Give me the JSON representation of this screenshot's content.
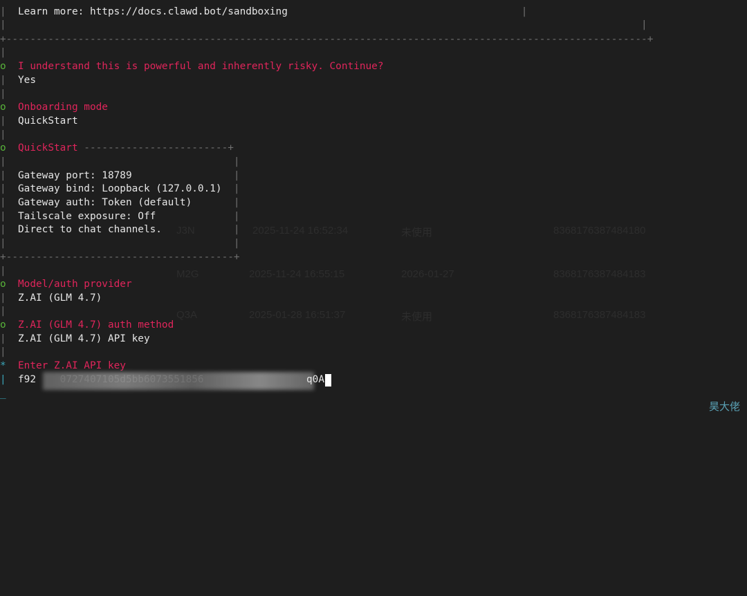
{
  "terminal": {
    "sandbox_box": {
      "learn_more": "Learn more: https://docs.clawd.bot/sandboxing"
    },
    "prompts": {
      "risk_question": "I understand this is powerful and inherently risky. Continue?",
      "risk_answer": "Yes",
      "onboarding_title": "Onboarding mode",
      "onboarding_value": "QuickStart",
      "quickstart_title": "QuickStart",
      "model_title": "Model/auth provider",
      "model_value": "Z.AI (GLM 4.7)",
      "auth_title": "Z.AI (GLM 4.7) auth method",
      "auth_value": "Z.AI (GLM 4.7) API key",
      "api_key_title": "Enter Z.AI API key",
      "api_key_visible_start": "f92",
      "api_key_obscured": "    0727407105d5bb6073551856",
      "api_key_visible_end": "q0A"
    },
    "quickstart_lines": [
      "Gateway port: 18789",
      "Gateway bind: Loopback (127.0.0.1)",
      "Gateway auth: Token (default)",
      "Tailscale exposure: Off",
      "Direct to chat channels."
    ]
  },
  "ghost_table": {
    "row_times": [
      "2025-11-24 16:52:34",
      "2025-11-24 16:55:15",
      "2025-01-28 16:51:37"
    ],
    "row_states": [
      "未使用",
      "2026-01-27",
      "未使用"
    ],
    "row_ids": [
      "8368176387484180",
      "8368176387484183",
      "8368176387484183"
    ],
    "row_codes": [
      "J3N",
      "M2G",
      "Q3A"
    ]
  },
  "watermark": "昊大佬",
  "colors": {
    "background": "#1e1e1e",
    "prompt_title": "#e0255b",
    "done_marker": "#58b33a",
    "active_marker": "#3aa6b9",
    "rail": "#707070"
  },
  "icons": {
    "done_marker": "o",
    "active_marker": "*",
    "rail": "|"
  }
}
